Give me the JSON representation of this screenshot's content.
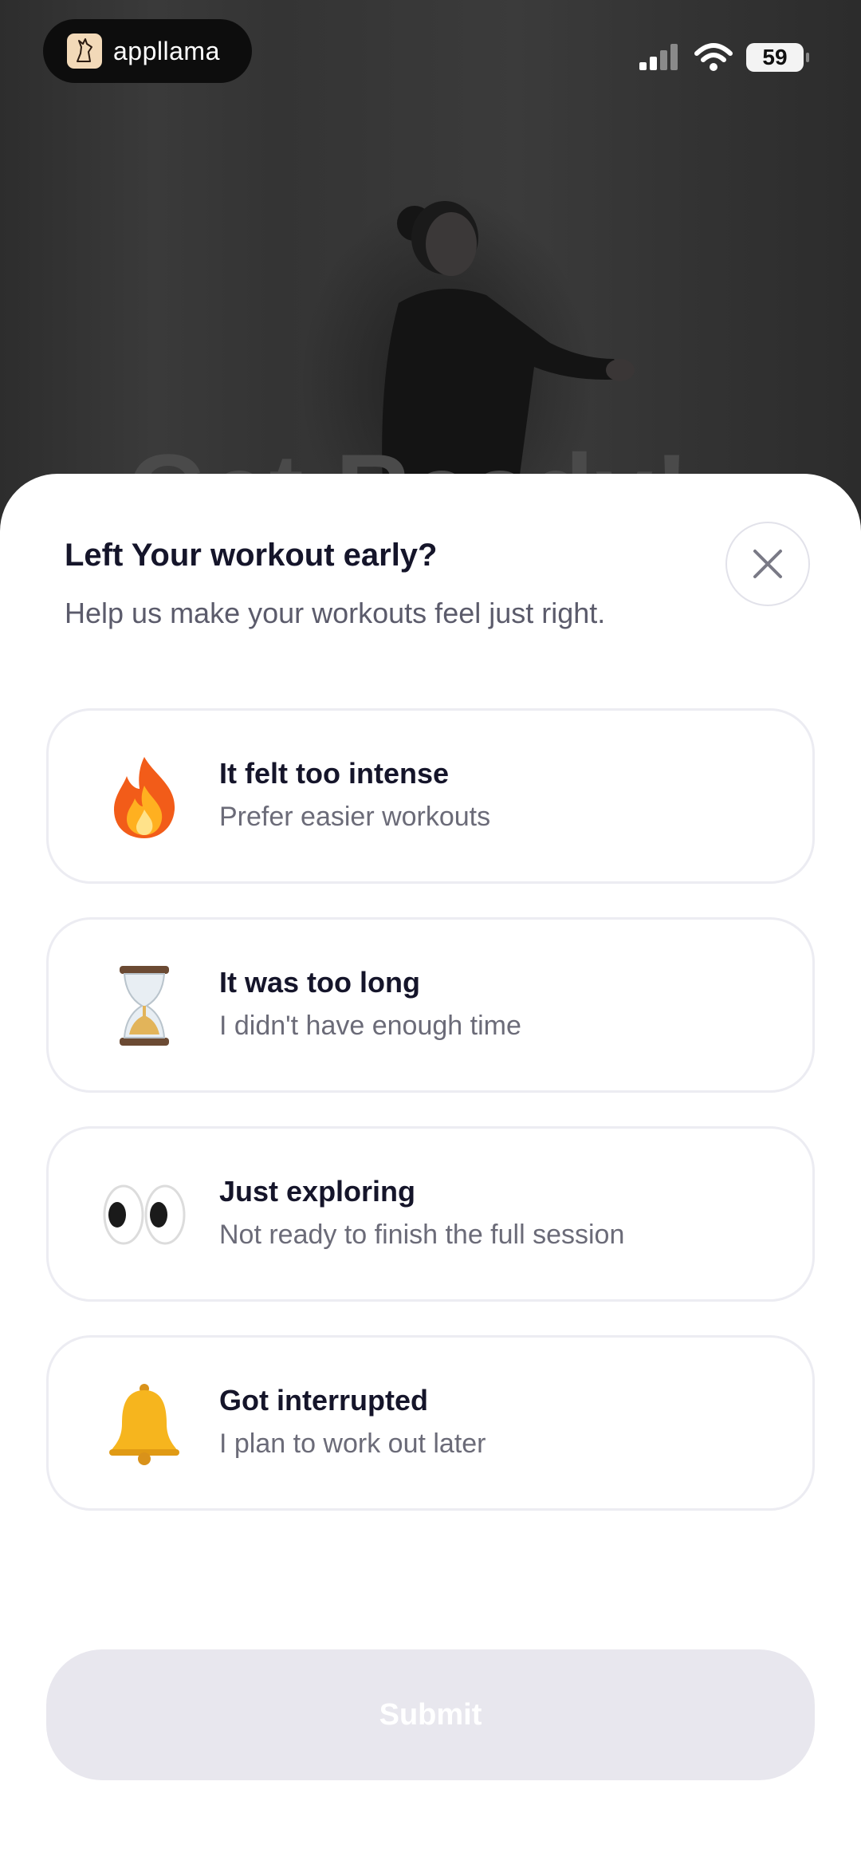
{
  "status_bar": {
    "app_name": "appllama",
    "battery": "59"
  },
  "background": {
    "heading": "Get Ready!"
  },
  "dialog": {
    "title": "Left Your workout early?",
    "subtitle": "Help us make your workouts feel just right.",
    "close_icon": "close-icon"
  },
  "options": [
    {
      "icon": "fire-icon",
      "title": "It felt too intense",
      "subtitle": "Prefer easier workouts"
    },
    {
      "icon": "hourglass-icon",
      "title": "It was too long",
      "subtitle": "I didn't have enough time"
    },
    {
      "icon": "eyes-icon",
      "title": "Just exploring",
      "subtitle": "Not ready to finish the full session"
    },
    {
      "icon": "bell-icon",
      "title": "Got interrupted",
      "subtitle": "I plan to work out later"
    }
  ],
  "submit": {
    "label": "Submit",
    "enabled": false
  },
  "colors": {
    "title": "#15152a",
    "subtitle": "#5b5b6b",
    "card_border": "#ececf2",
    "submit_disabled": "#e8e7ee"
  }
}
